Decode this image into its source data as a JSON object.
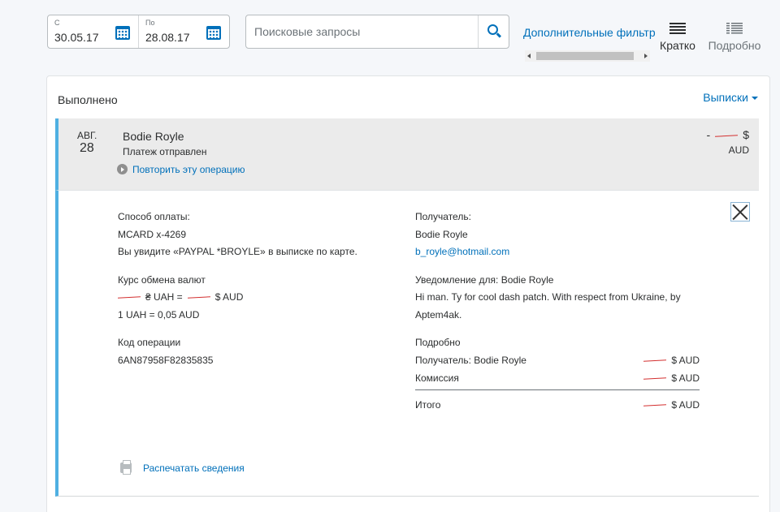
{
  "filters": {
    "from_label": "С",
    "from_value": "30.05.17",
    "to_label": "По",
    "to_value": "28.08.17",
    "search_placeholder": "Поисковые запросы",
    "advanced_filter": "Дополнительные фильтр",
    "view_brief": "Кратко",
    "view_detailed": "Подробно"
  },
  "card": {
    "status": "Выполнено",
    "statements": "Выписки"
  },
  "transaction": {
    "month": "АВГ.",
    "day": "28",
    "name": "Bodie Royle",
    "subtitle": "Платеж отправлен",
    "repeat": "Повторить эту операцию",
    "amount_sign": "-",
    "amount_symbol": "$",
    "currency": "AUD"
  },
  "details": {
    "payment_method_label": "Способ оплаты:",
    "payment_method_value": "MCARD x-4269",
    "statement_note": "Вы увидите «PAYPAL *BROYLE» в выписке по карте.",
    "exchange_label": "Курс обмена валют",
    "exchange_uah": "₴ UAH =",
    "exchange_aud": "$ AUD",
    "exchange_rate": "1 UAH = 0,05 AUD",
    "txn_id_label": "Код операции",
    "txn_id_value": "6AN87958F82835835",
    "recipient_label": "Получатель:",
    "recipient_name": "Bodie Royle",
    "recipient_email": "b_royle@hotmail.com",
    "notify_label": "Уведомление для: Bodie Royle",
    "notify_message": "Hi man. Ty for cool dash patch. With respect from Ukraine, by Aptem4ak.",
    "breakdown_label": "Подробно",
    "breakdown_recipient": "Получатель: Bodie Royle",
    "breakdown_recipient_amount": "$ AUD",
    "breakdown_fee": "Комиссия",
    "breakdown_fee_amount": "$ AUD",
    "breakdown_total": "Итого",
    "breakdown_total_amount": "$ AUD",
    "print": "Распечатать сведения"
  }
}
